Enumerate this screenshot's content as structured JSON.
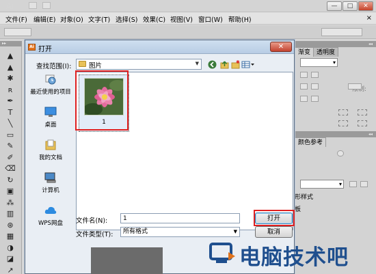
{
  "app": {
    "logo": "Ai",
    "window_buttons": [
      "—",
      "□",
      "✕"
    ]
  },
  "menubar": {
    "items": [
      "文件(F)",
      "编辑(E)",
      "对象(O)",
      "文字(T)",
      "选择(S)",
      "效果(C)",
      "视图(V)",
      "窗口(W)",
      "帮助(H)"
    ],
    "close_glyph": "×"
  },
  "toolbox": {
    "tools": [
      "▲",
      "▲",
      "✱",
      "ʀ",
      "✒",
      "T",
      "╲",
      "▭",
      "✎",
      "✐",
      "⌫",
      "↻",
      "▣",
      "⁂",
      "▥",
      "⊛",
      "▦",
      "◑",
      "◪",
      "↗"
    ]
  },
  "right_panels": {
    "tabs_top": [
      "渐变",
      "透明度"
    ],
    "limit_label": "限制:",
    "tab_color_guide": "颜色参考",
    "panel_shape": "形样式",
    "panel_board": "板"
  },
  "dialog": {
    "title": "打开",
    "close_glyph": "✕",
    "look_in_label": "查找范围(I):",
    "look_in_value": "图片",
    "nav_icons": [
      "back-icon",
      "up-folder-icon",
      "new-folder-icon",
      "view-menu-icon"
    ],
    "places": [
      {
        "label": "最近使用的项目",
        "icon": "recent-items-icon"
      },
      {
        "label": "桌面",
        "icon": "desktop-icon"
      },
      {
        "label": "我的文档",
        "icon": "documents-icon"
      },
      {
        "label": "计算机",
        "icon": "computer-icon"
      },
      {
        "label": "WPS网盘",
        "icon": "wps-cloud-icon"
      }
    ],
    "files": [
      {
        "name": "1",
        "thumbnail": "pink-flower-image"
      }
    ],
    "file_name_label": "文件名(N):",
    "file_name_value": "1",
    "file_type_label": "文件类型(T):",
    "file_type_value": "所有格式",
    "open_label": "打开",
    "cancel_label": "取消"
  },
  "watermark": {
    "text": "电脑技术吧"
  },
  "colors": {
    "highlight_red": "#e02020",
    "dialog_title_blue": "#b8cde4",
    "watermark_blue": "#1f4f8e"
  }
}
